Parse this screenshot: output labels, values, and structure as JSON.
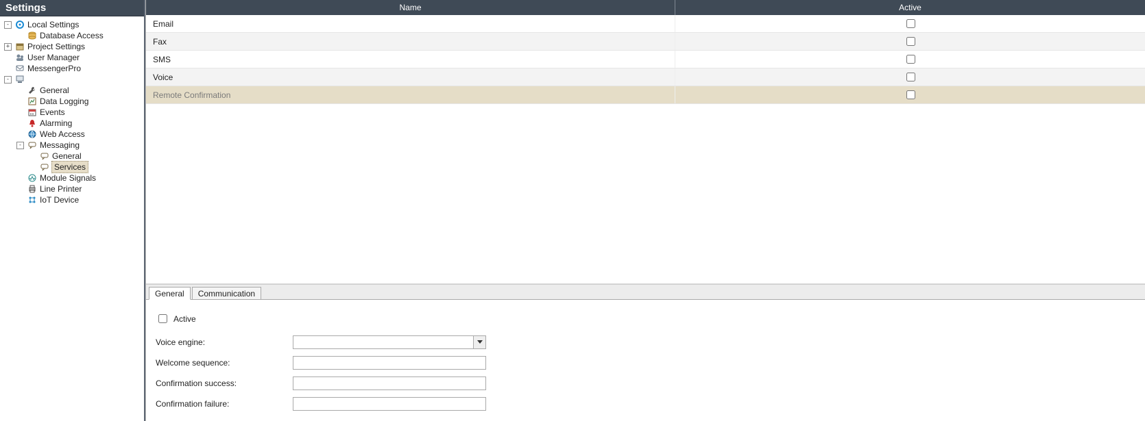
{
  "sidebar": {
    "title": "Settings",
    "tree": [
      {
        "id": "local",
        "label": "Local Settings",
        "level": 0,
        "toggle": "-",
        "icon": "gear-blue"
      },
      {
        "id": "db",
        "label": "Database Access",
        "level": 1,
        "toggle": " ",
        "icon": "db-icon"
      },
      {
        "id": "proj",
        "label": "Project Settings",
        "level": 0,
        "toggle": "+",
        "icon": "proj-icon"
      },
      {
        "id": "usermgr",
        "label": "User Manager",
        "level": 0,
        "toggle": " ",
        "icon": "users-icon"
      },
      {
        "id": "msgpro",
        "label": "MessengerPro",
        "level": 0,
        "toggle": " ",
        "icon": "msgpro-icon"
      },
      {
        "id": "pc",
        "label": "",
        "level": 0,
        "toggle": "-",
        "icon": "pc-icon"
      },
      {
        "id": "general",
        "label": "General",
        "level": 1,
        "toggle": " ",
        "icon": "wrench-icon"
      },
      {
        "id": "datalog",
        "label": "Data Logging",
        "level": 1,
        "toggle": " ",
        "icon": "datalog-icon"
      },
      {
        "id": "events",
        "label": "Events",
        "level": 1,
        "toggle": " ",
        "icon": "calendar-icon"
      },
      {
        "id": "alarm",
        "label": "Alarming",
        "level": 1,
        "toggle": " ",
        "icon": "bell-icon"
      },
      {
        "id": "web",
        "label": "Web Access",
        "level": 1,
        "toggle": " ",
        "icon": "globe-icon"
      },
      {
        "id": "msg",
        "label": "Messaging",
        "level": 1,
        "toggle": "-",
        "icon": "chat-icon"
      },
      {
        "id": "msg-gen",
        "label": "General",
        "level": 2,
        "toggle": " ",
        "icon": "chat-icon"
      },
      {
        "id": "msg-svc",
        "label": "Services",
        "level": 2,
        "toggle": " ",
        "icon": "chat-icon",
        "selected": true
      },
      {
        "id": "modsig",
        "label": "Module Signals",
        "level": 1,
        "toggle": " ",
        "icon": "signal-icon"
      },
      {
        "id": "lp",
        "label": "Line Printer",
        "level": 1,
        "toggle": " ",
        "icon": "printer-icon"
      },
      {
        "id": "iot",
        "label": "IoT Device",
        "level": 1,
        "toggle": " ",
        "icon": "iot-icon"
      }
    ]
  },
  "table": {
    "columns": {
      "name": "Name",
      "active": "Active"
    },
    "rows": [
      {
        "name": "Email",
        "active": false
      },
      {
        "name": "Fax",
        "active": false
      },
      {
        "name": "SMS",
        "active": false
      },
      {
        "name": "Voice",
        "active": false
      },
      {
        "name": "Remote Confirmation",
        "active": false,
        "selected": true
      }
    ]
  },
  "tabs": {
    "general": "General",
    "communication": "Communication"
  },
  "form": {
    "active_label": "Active",
    "active_checked": false,
    "voice_engine_label": "Voice engine:",
    "voice_engine_value": "",
    "welcome_label": "Welcome sequence:",
    "welcome_value": "",
    "conf_success_label": "Confirmation success:",
    "conf_success_value": "",
    "conf_failure_label": "Confirmation failure:",
    "conf_failure_value": ""
  }
}
